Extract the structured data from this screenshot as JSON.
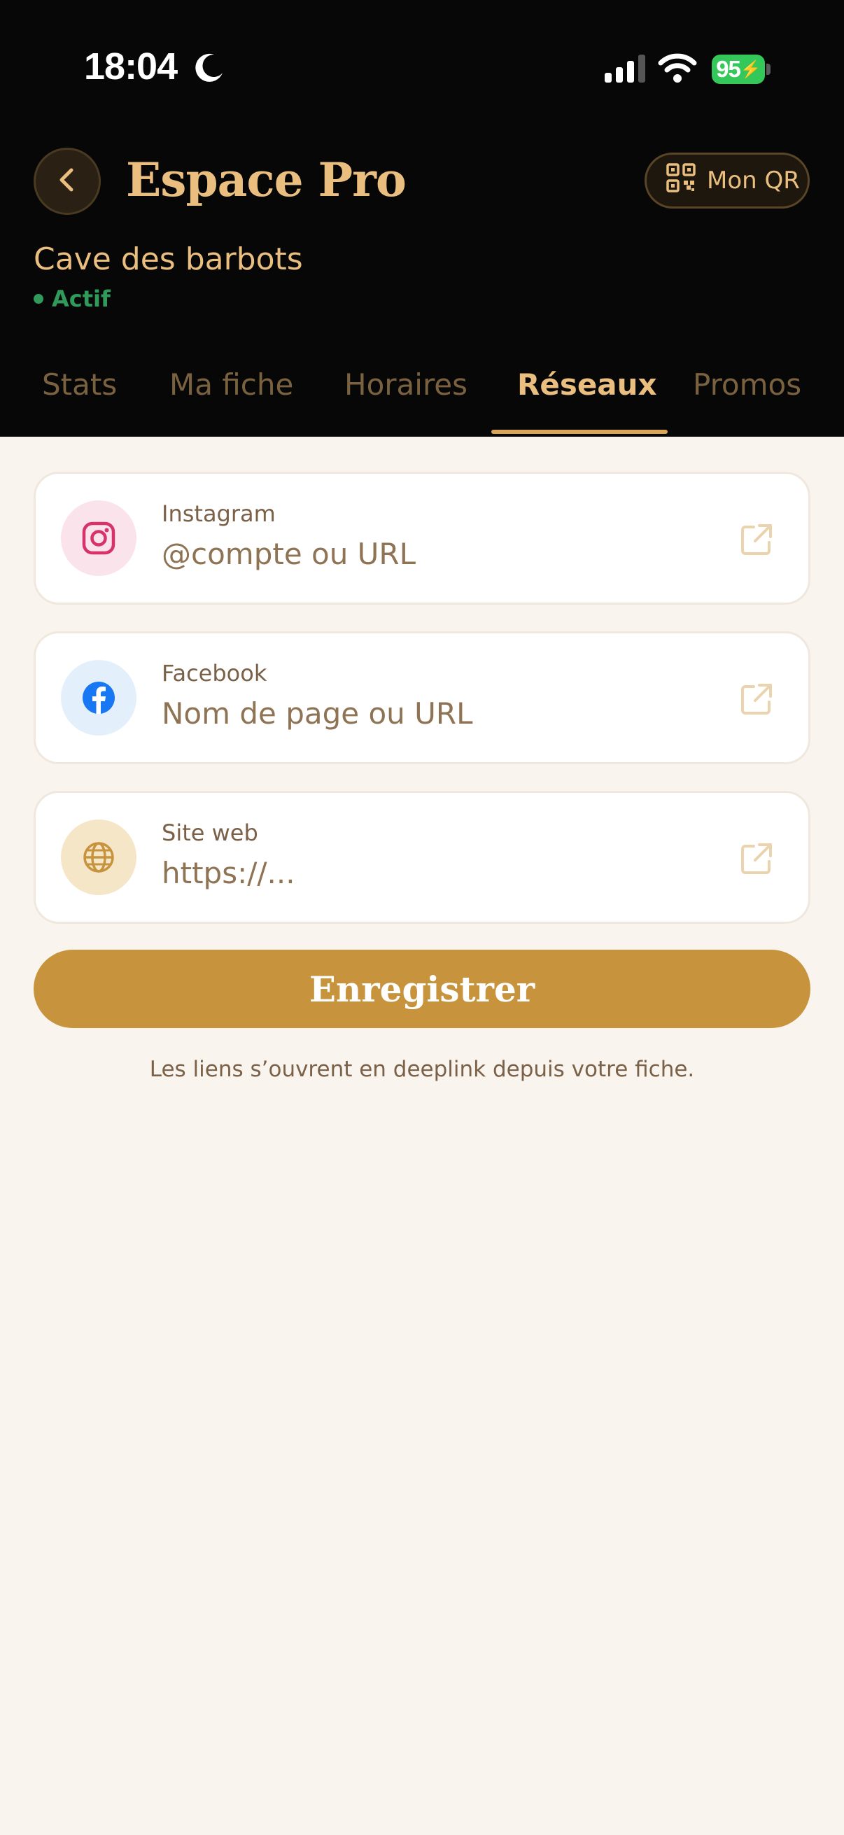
{
  "status_bar": {
    "time": "18:04",
    "battery": "95"
  },
  "header": {
    "title": "Espace Pro",
    "qr_button_label": "Mon QR",
    "venue_name": "Cave des barbots",
    "status": "Actif"
  },
  "tabs": [
    {
      "label": "Stats",
      "active": false
    },
    {
      "label": "Ma fiche",
      "active": false
    },
    {
      "label": "Horaires",
      "active": false
    },
    {
      "label": "Réseaux",
      "active": true
    },
    {
      "label": "Promos",
      "active": false
    }
  ],
  "fields": [
    {
      "label": "Instagram",
      "placeholder": "@compte ou URL",
      "value": "",
      "icon": "instagram-icon"
    },
    {
      "label": "Facebook",
      "placeholder": "Nom de page ou URL",
      "value": "",
      "icon": "facebook-icon"
    },
    {
      "label": "Site web",
      "placeholder": "https://...",
      "value": "",
      "icon": "globe-icon"
    }
  ],
  "save_button_label": "Enregistrer",
  "hint": "Les liens s’ouvrent en deeplink depuis votre fiche.",
  "colors": {
    "header_bg": "#070707",
    "accent_gold": "#E9BE7E",
    "button_gold": "#C8933D",
    "page_bg": "#F9F4EE",
    "active_green": "#2F9A5A"
  }
}
